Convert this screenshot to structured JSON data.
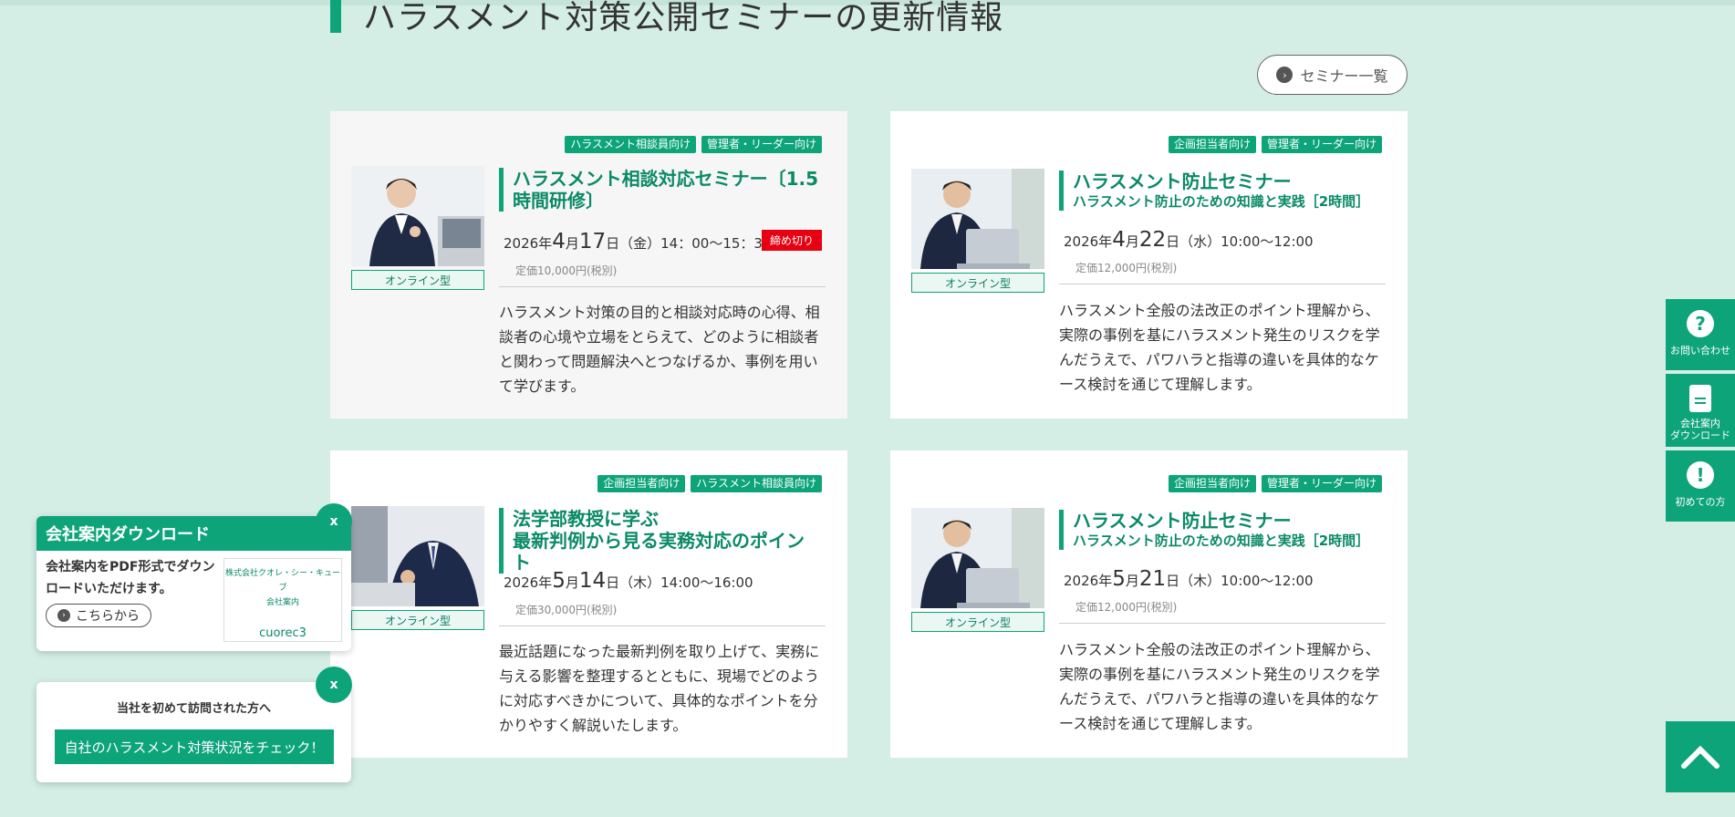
{
  "section": {
    "title": "ハラスメント対策公開セミナーの更新情報",
    "list_button": "セミナー一覧"
  },
  "cards": [
    {
      "tags": [
        "ハラスメント相談員向け",
        "管理者・リーダー向け"
      ],
      "title": "ハラスメント相談対応セミナー〔1.5時間研修〕",
      "subtitle": "",
      "format": "オンライン型",
      "date_year": "2026年",
      "date_month": "4",
      "date_month_unit": "月",
      "date_day": "17",
      "date_day_unit": "日",
      "date_rest": "（金）14：00〜15：30",
      "price": "定価10,000円(税別)",
      "status": "締め切り",
      "description": "ハラスメント対策の目的と相談対応時の心得、相談者の心境や立場をとらえて、どのように相談者と関わって問題解決へとつなげるか、事例を用いて学びます。"
    },
    {
      "tags": [
        "企画担当者向け",
        "管理者・リーダー向け"
      ],
      "title": "ハラスメント防止セミナー",
      "subtitle": "ハラスメント防止のための知識と実践［2時間］",
      "format": "オンライン型",
      "date_year": "2026年",
      "date_month": "4",
      "date_month_unit": "月",
      "date_day": "22",
      "date_day_unit": "日",
      "date_rest": "（水）10:00〜12:00",
      "price": "定価12,000円(税別)",
      "status": "",
      "description": "ハラスメント全般の法改正のポイント理解から、実際の事例を基にハラスメント発生のリスクを学んだうえで、パワハラと指導の違いを具体的なケース検討を通じて理解します。"
    },
    {
      "tags": [
        "企画担当者向け",
        "ハラスメント相談員向け"
      ],
      "title": "法学部教授に学ぶ",
      "subtitle": "最新判例から見る実務対応のポイント",
      "format": "オンライン型",
      "date_year": "2026年",
      "date_month": "5",
      "date_month_unit": "月",
      "date_day": "14",
      "date_day_unit": "日",
      "date_rest": "（木）14:00〜16:00",
      "price": "定価30,000円(税別)",
      "status": "",
      "description": "最近話題になった最新判例を取り上げて、実務に与える影響を整理するとともに、現場でどのように対応すべきかについて、具体的なポイントを分かりやすく解説いたします。"
    },
    {
      "tags": [
        "企画担当者向け",
        "管理者・リーダー向け"
      ],
      "title": "ハラスメント防止セミナー",
      "subtitle": "ハラスメント防止のための知識と実践［2時間］",
      "format": "オンライン型",
      "date_year": "2026年",
      "date_month": "5",
      "date_month_unit": "月",
      "date_day": "21",
      "date_day_unit": "日",
      "date_rest": "（木）10:00〜12:00",
      "price": "定価12,000円(税別)",
      "status": "",
      "description": "ハラスメント全般の法改正のポイント理解から、実際の事例を基にハラスメント発生のリスクを学んだうえで、パワハラと指導の違いを具体的なケース検討を通じて理解します。"
    }
  ],
  "side_tabs": {
    "contact": "お問い合わせ",
    "download_line1": "会社案内",
    "download_line2": "ダウンロード",
    "first_time": "初めての方"
  },
  "popup_download": {
    "title": "会社案内ダウンロード",
    "text": "会社案内をPDF形式でダウンロードいただけます。",
    "button": "こちらから",
    "close": "x",
    "cover_company": "株式会社クオレ・シー・キューブ",
    "cover_label": "会社案内",
    "cover_logo": "cuorec3"
  },
  "popup_check": {
    "lead": "当社を初めて訪問された方へ",
    "button": "自社のハラスメント対策状況をチェック！",
    "close": "x"
  },
  "colors": {
    "background": "#d4eee6",
    "accent": "#0ea47a",
    "closed": "#e60012"
  }
}
